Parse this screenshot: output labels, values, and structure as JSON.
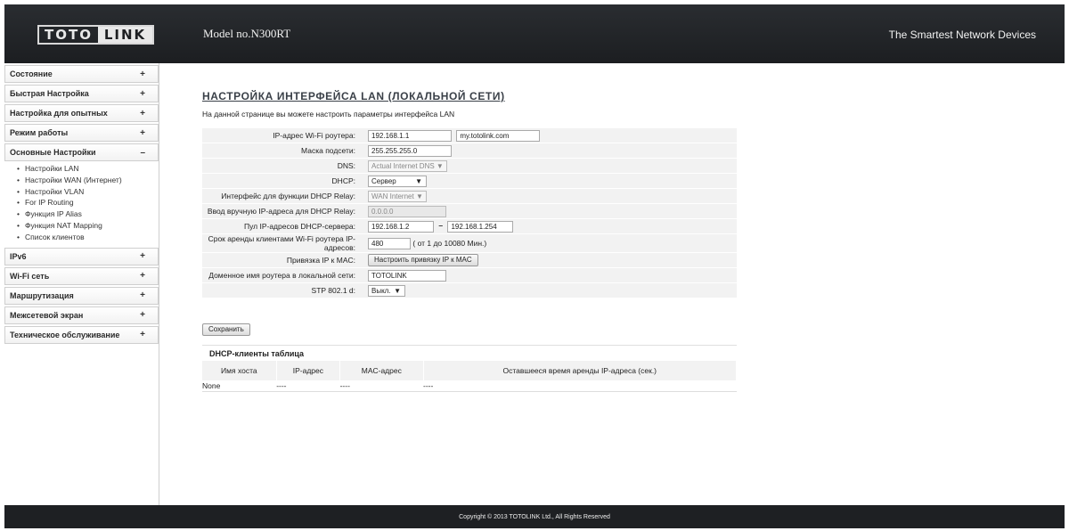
{
  "header": {
    "logo_left": "TOTO",
    "logo_right": "LINK",
    "model": "Model no.N300RT",
    "tagline": "The Smartest Network Devices"
  },
  "sidebar": {
    "menu": [
      {
        "label": "Состояние",
        "toggle": "+"
      },
      {
        "label": "Быстрая Настройка",
        "toggle": "+"
      },
      {
        "label": "Настройка для опытных",
        "toggle": "+"
      },
      {
        "label": "Режим работы",
        "toggle": "+"
      },
      {
        "label": "Основные Настройки",
        "toggle": "–"
      }
    ],
    "submenu": [
      "Настройки LAN",
      "Настройки WAN (Интернет)",
      "Настройки VLAN",
      "For IP Routing",
      "Функция IP Alias",
      "Функция NAT Mapping",
      "Список клиентов"
    ],
    "menu2": [
      {
        "label": "IPv6",
        "toggle": "+"
      },
      {
        "label": "Wi-Fi сеть",
        "toggle": "+"
      },
      {
        "label": "Маршрутизация",
        "toggle": "+"
      },
      {
        "label": "Межсетевой экран",
        "toggle": "+"
      },
      {
        "label": "Техническое обслуживание",
        "toggle": "+"
      }
    ]
  },
  "main": {
    "title": "НАСТРОЙКА ИНТЕРФЕЙСА LAN (ЛОКАЛЬНОЙ СЕТИ)",
    "description": "На данной странице вы можете настроить параметры интерфейса LAN",
    "form": {
      "ip_label": "IP-адрес Wi-Fi роутера:",
      "ip_value": "192.168.1.1",
      "domain_value": "my.totolink.com",
      "mask_label": "Маска подсети:",
      "mask_value": "255.255.255.0",
      "dns_label": "DNS:",
      "dns_value": "Actual Internet DNS ▼",
      "dhcp_label": "DHCP:",
      "dhcp_value": "Сервер",
      "relay_if_label": "Интерфейс для функции DHCP Relay:",
      "relay_if_value": "WAN Internet ▼",
      "relay_ip_label": "Ввод вручную IP-адреса для DHCP Relay:",
      "relay_ip_value": "0.0.0.0",
      "pool_label": "Пул IP-адресов DHCP-сервера:",
      "pool_start": "192.168.1.2",
      "pool_sep": "–",
      "pool_end": "192.168.1.254",
      "lease_label": "Срок аренды клиентами Wi-Fi роутера IP-адресов:",
      "lease_value": "480",
      "lease_hint": "( от 1 до 10080 Мин.)",
      "bind_label": "Привязка IP к MAC:",
      "bind_button": "Настроить привязку IP к MAC",
      "hostname_label": "Доменное имя роутера в локальной сети:",
      "hostname_value": "TOTOLINK",
      "stp_label": "STP 802.1 d:",
      "stp_value": "Выкл."
    },
    "save_button": "Сохранить",
    "dhcp_table": {
      "title": "DHCP-клиенты таблица",
      "headers": [
        "Имя хоста",
        "IP-адрес",
        "MAC-адрес",
        "Оставшееся время аренды IP-адреса (сек.)"
      ],
      "rows": [
        [
          "None",
          "----",
          "----",
          "----"
        ]
      ]
    }
  },
  "footer": {
    "copyright": "Copyright © 2013 TOTOLINK Ltd.,   All Rights Reserved"
  }
}
